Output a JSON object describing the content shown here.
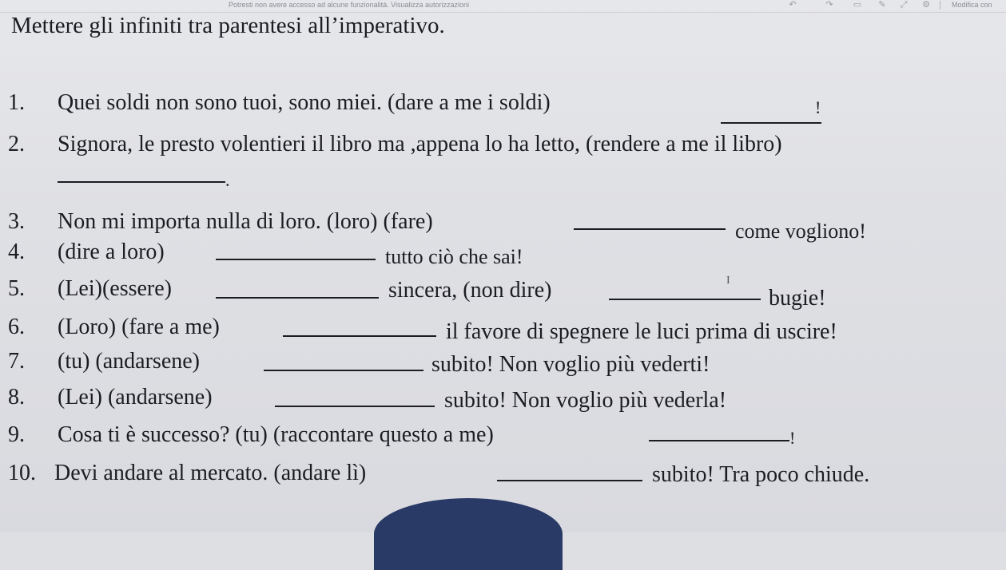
{
  "toolbar": {
    "notice": "Potresti non avere accesso ad alcune funzionalità. Visualizza autorizzazioni",
    "edit_label": "Modifica con",
    "icons": [
      "undo-icon",
      "redo-icon",
      "zoom-icon",
      "pen-icon",
      "expand-icon",
      "settings-icon"
    ]
  },
  "exercise": {
    "title": "Mettere gli infiniti tra parentesi all’imperativo.",
    "items": [
      {
        "num": "1.",
        "a": "Quei soldi non sono tuoi, sono miei. (dare a me i soldi)",
        "b": "!"
      },
      {
        "num": "2.",
        "a": "Signora, le presto volentieri il libro ma ,appena lo ha letto, (rendere a me il libro)",
        "b": "."
      },
      {
        "num": "3.",
        "a": "Non mi importa nulla di loro. (loro) (fare)",
        "b": "come vogliono!"
      },
      {
        "num": "4.",
        "a": "(dire a loro)",
        "b": "tutto ciò che sai!"
      },
      {
        "num": "5.",
        "a": "(Lei)(essere)",
        "b": "sincera, (non dire)",
        "c": "bugie!"
      },
      {
        "num": "6.",
        "a": "(Loro) (fare a me)",
        "b": "il favore di spegnere le luci prima di uscire!"
      },
      {
        "num": "7.",
        "a": "(tu) (andarsene)",
        "b": "subito! Non voglio più vederti!"
      },
      {
        "num": "8.",
        "a": "(Lei) (andarsene)",
        "b": "subito! Non voglio più vederla!"
      },
      {
        "num": "9.",
        "a": "Cosa ti è successo? (tu) (raccontare questo a me)",
        "b": "!"
      },
      {
        "num": "10.",
        "a": "Devi andare al mercato. (andare lì)",
        "b": "subito! Tra poco chiude."
      }
    ]
  }
}
